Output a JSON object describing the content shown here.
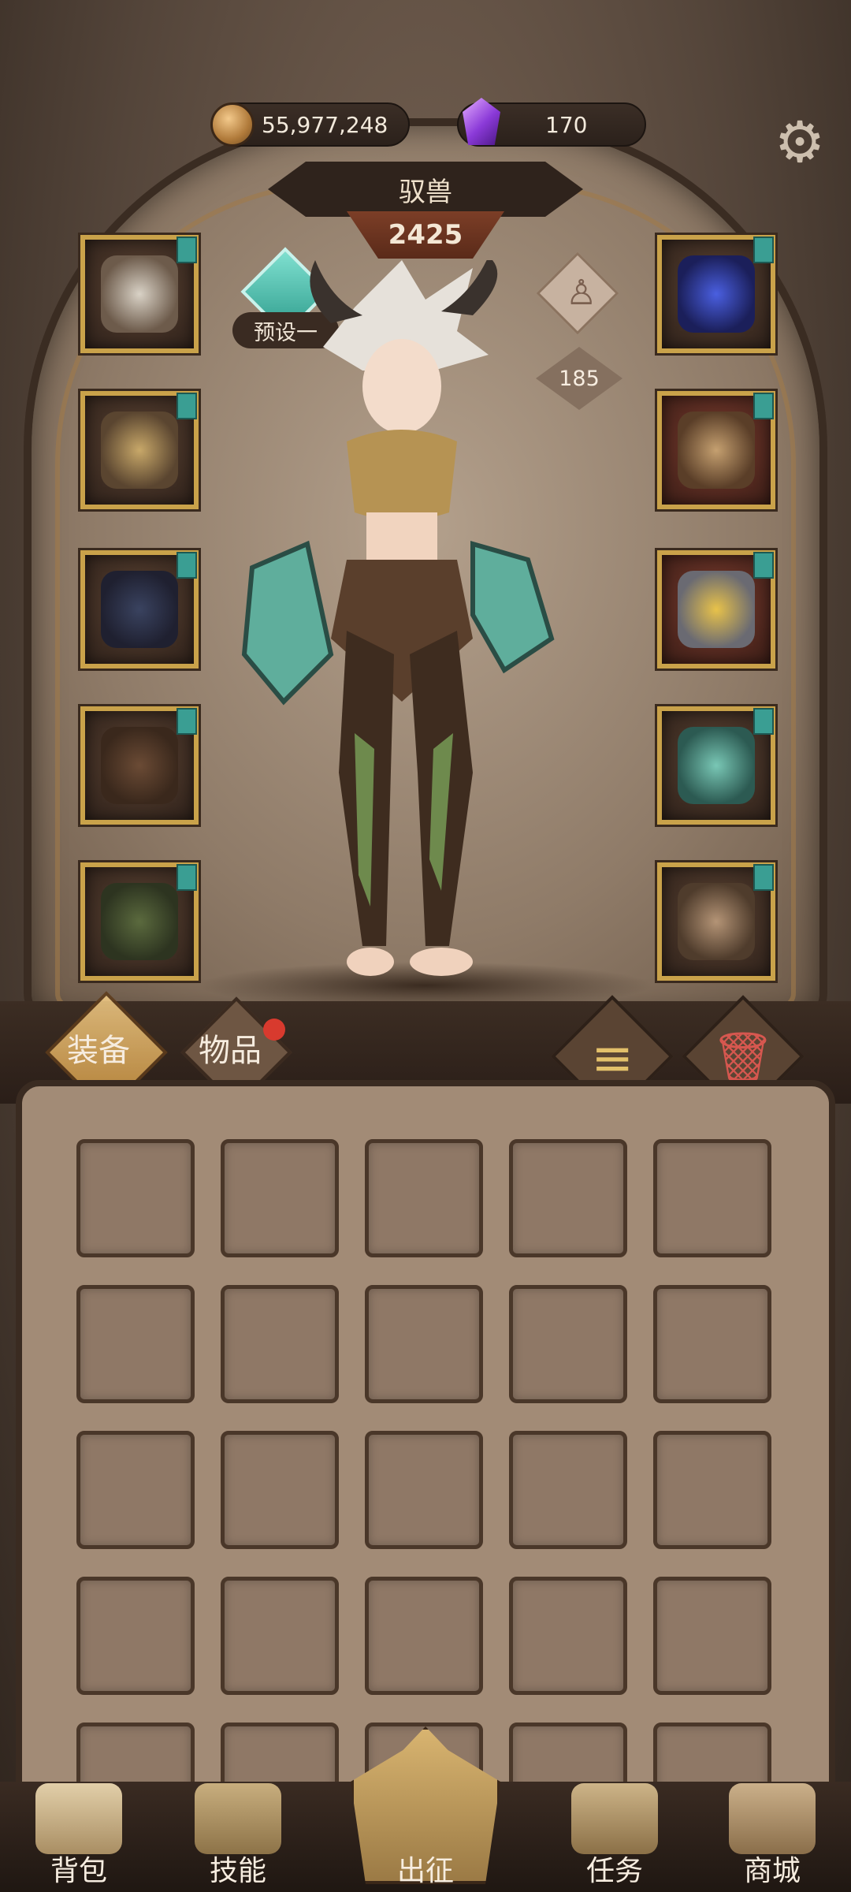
{
  "currency": {
    "coins": "55,977,248",
    "gems": "170"
  },
  "icons": {
    "settings": "gear-icon",
    "coin": "coin-icon",
    "gem": "gem-icon"
  },
  "hero": {
    "class_name": "驭兽",
    "power": "2425",
    "preset_label": "预设一",
    "level": "185"
  },
  "tabs": {
    "equipment": "装备",
    "items": "物品"
  },
  "nav": {
    "bag": "背包",
    "skills": "技能",
    "fight": "出征",
    "quests": "任务",
    "shop": "商城"
  },
  "colors": {
    "frame_gold": "#c9a24a",
    "preset_teal": "#3a9e93",
    "notify_red": "#d83a2e"
  }
}
